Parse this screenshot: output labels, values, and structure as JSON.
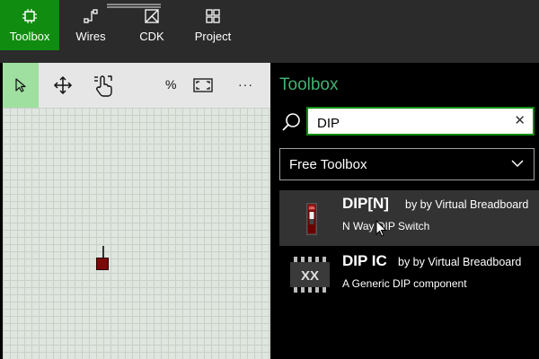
{
  "nav": {
    "items": [
      {
        "label": "Toolbox",
        "icon": "chip-icon",
        "active": true
      },
      {
        "label": "Wires",
        "icon": "wires-icon",
        "active": false
      },
      {
        "label": "CDK",
        "icon": "cdk-icon",
        "active": false
      },
      {
        "label": "Project",
        "icon": "grid-icon",
        "active": false
      }
    ]
  },
  "toolbar": {
    "percent_label": "%",
    "more_label": "···"
  },
  "panel": {
    "title": "Toolbox",
    "search": {
      "value": "DIP",
      "clear": "✕"
    },
    "dropdown": {
      "selected": "Free Toolbox"
    },
    "results": [
      {
        "name": "DIP[N]",
        "by": "by by Virtual Breadboard",
        "description": "N Way DIP Switch",
        "icon": "dip-switch-icon"
      },
      {
        "name": "DIP IC",
        "by": "by by Virtual Breadboard",
        "description": "A Generic DIP component",
        "icon": "dip-ic-icon"
      }
    ]
  },
  "colors": {
    "accent": "#108c10",
    "title_green": "#3cb371",
    "selected_tool": "#9fdf9f"
  }
}
